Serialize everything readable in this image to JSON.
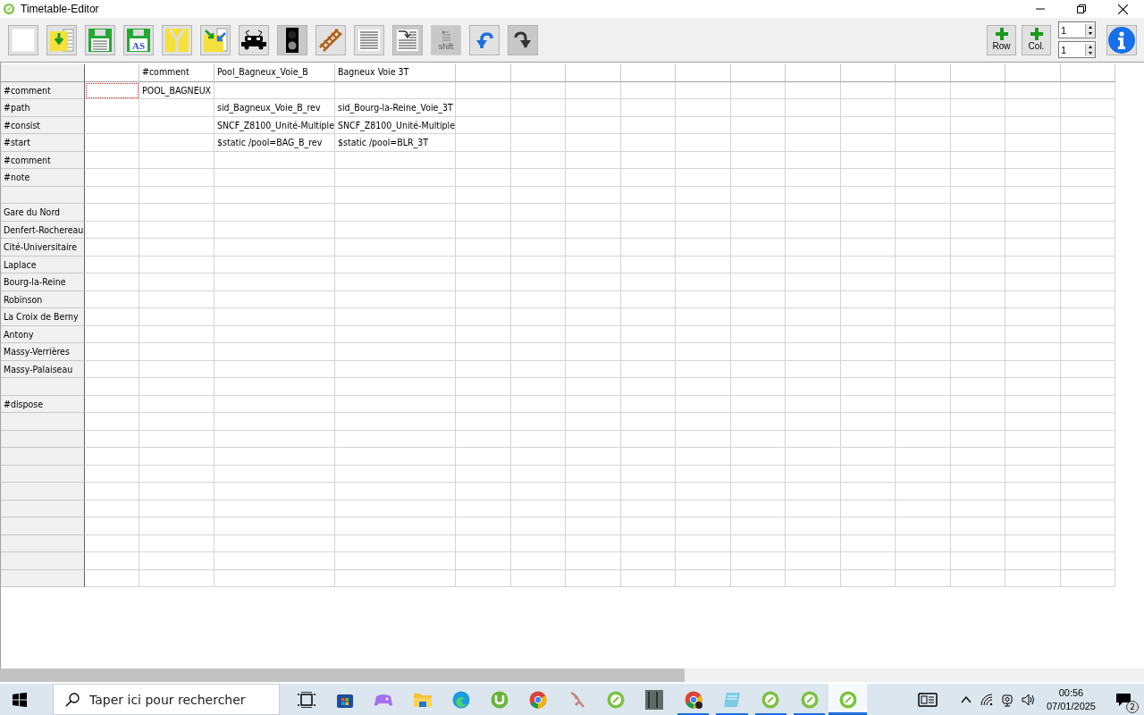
{
  "window": {
    "title": "Timetable-Editor"
  },
  "toolbar": [
    {
      "kind": "new",
      "pressed": false,
      "disabled": false
    },
    {
      "kind": "open",
      "pressed": false,
      "disabled": false
    },
    {
      "kind": "save",
      "pressed": false,
      "disabled": false
    },
    {
      "kind": "save-as",
      "label": "AS",
      "pressed": false,
      "disabled": false
    },
    {
      "kind": "zip",
      "pressed": false,
      "disabled": false
    },
    {
      "kind": "import",
      "pressed": false,
      "disabled": false
    },
    {
      "kind": "train",
      "pressed": false,
      "disabled": false
    },
    {
      "kind": "signal",
      "pressed": true,
      "disabled": false
    },
    {
      "kind": "track",
      "pressed": false,
      "disabled": false
    },
    {
      "kind": "document",
      "pressed": false,
      "disabled": false
    },
    {
      "kind": "insert",
      "pressed": true,
      "disabled": false
    },
    {
      "kind": "shift",
      "label": "shift",
      "pressed": true,
      "disabled": true
    },
    {
      "kind": "undo",
      "pressed": false,
      "disabled": false
    },
    {
      "kind": "redo",
      "pressed": true,
      "disabled": false
    }
  ],
  "add_buttons": [
    {
      "label": "Row"
    },
    {
      "label": "Col."
    }
  ],
  "spinners": [
    {
      "value": "1"
    },
    {
      "value": "1"
    }
  ],
  "table": {
    "columns": [
      {
        "label": "#comment"
      },
      {
        "label": "Pool_Bagneux_Voie_B"
      },
      {
        "label": "Bagneux Voie 3T"
      }
    ],
    "rows": [
      {
        "label": "#comment",
        "focused": true,
        "cells": [
          "POOL_BAGNEUX",
          null,
          null
        ]
      },
      {
        "label": "#path",
        "focused": false,
        "cells": [
          null,
          "sid_Bagneux_Voie_B_rev",
          "sid_Bourg-la-Reine_Voie_3T"
        ]
      },
      {
        "label": "#consist",
        "focused": false,
        "cells": [
          null,
          "SNCF_Z8100_Unité-Multiple",
          "SNCF_Z8100_Unité-Multiple"
        ]
      },
      {
        "label": "#start",
        "focused": false,
        "cells": [
          null,
          "$static /pool=BAG_B_rev",
          "$static /pool=BLR_3T"
        ]
      },
      {
        "label": "#comment",
        "focused": false
      },
      {
        "label": "#note",
        "focused": false
      },
      {
        "focused": false
      },
      {
        "label": "Gare du Nord",
        "focused": false
      },
      {
        "label": "Denfert-Rochereau",
        "focused": false
      },
      {
        "label": "Cité-Universitaire",
        "focused": false
      },
      {
        "label": "Laplace",
        "focused": false
      },
      {
        "label": "Bourg-la-Reine",
        "focused": false
      },
      {
        "label": "Robinson",
        "focused": false
      },
      {
        "label": "La Croix de Berny",
        "focused": false
      },
      {
        "label": "Antony",
        "focused": false
      },
      {
        "label": "Massy-Verrières",
        "focused": false
      },
      {
        "label": "Massy-Palaiseau",
        "focused": false
      },
      {
        "focused": false
      },
      {
        "label": "#dispose",
        "focused": false
      },
      {
        "focused": false
      },
      {
        "focused": false
      },
      {
        "focused": false
      },
      {
        "focused": false
      },
      {
        "focused": false
      },
      {
        "focused": false
      },
      {
        "focused": false
      },
      {
        "focused": false
      },
      {
        "focused": false
      },
      {
        "focused": false
      }
    ]
  },
  "taskbar": {
    "search": {
      "placeholder": "Taper ici pour rechercher"
    },
    "apps": [
      {
        "kind": "task-view",
        "running": false,
        "selected": false
      },
      {
        "kind": "store",
        "running": false,
        "selected": false
      },
      {
        "kind": "gamepad",
        "running": false,
        "selected": false
      },
      {
        "kind": "folder",
        "running": false,
        "selected": false
      },
      {
        "kind": "edge",
        "running": false,
        "selected": false
      },
      {
        "kind": "torrent",
        "running": false,
        "selected": false
      },
      {
        "kind": "chrome",
        "running": false,
        "selected": false
      },
      {
        "kind": "creature",
        "running": false,
        "selected": false
      },
      {
        "kind": "green",
        "running": false,
        "selected": false
      },
      {
        "kind": "photo",
        "running": false,
        "selected": false
      },
      {
        "kind": "chrome",
        "running": true,
        "selected": false
      },
      {
        "kind": "notepad",
        "running": true,
        "selected": false
      },
      {
        "kind": "green",
        "running": true,
        "selected": false
      },
      {
        "kind": "green",
        "running": true,
        "selected": false
      },
      {
        "kind": "green",
        "running": true,
        "selected": true
      }
    ],
    "time": "00:56",
    "date": "07/01/2025",
    "notifications": "2"
  }
}
